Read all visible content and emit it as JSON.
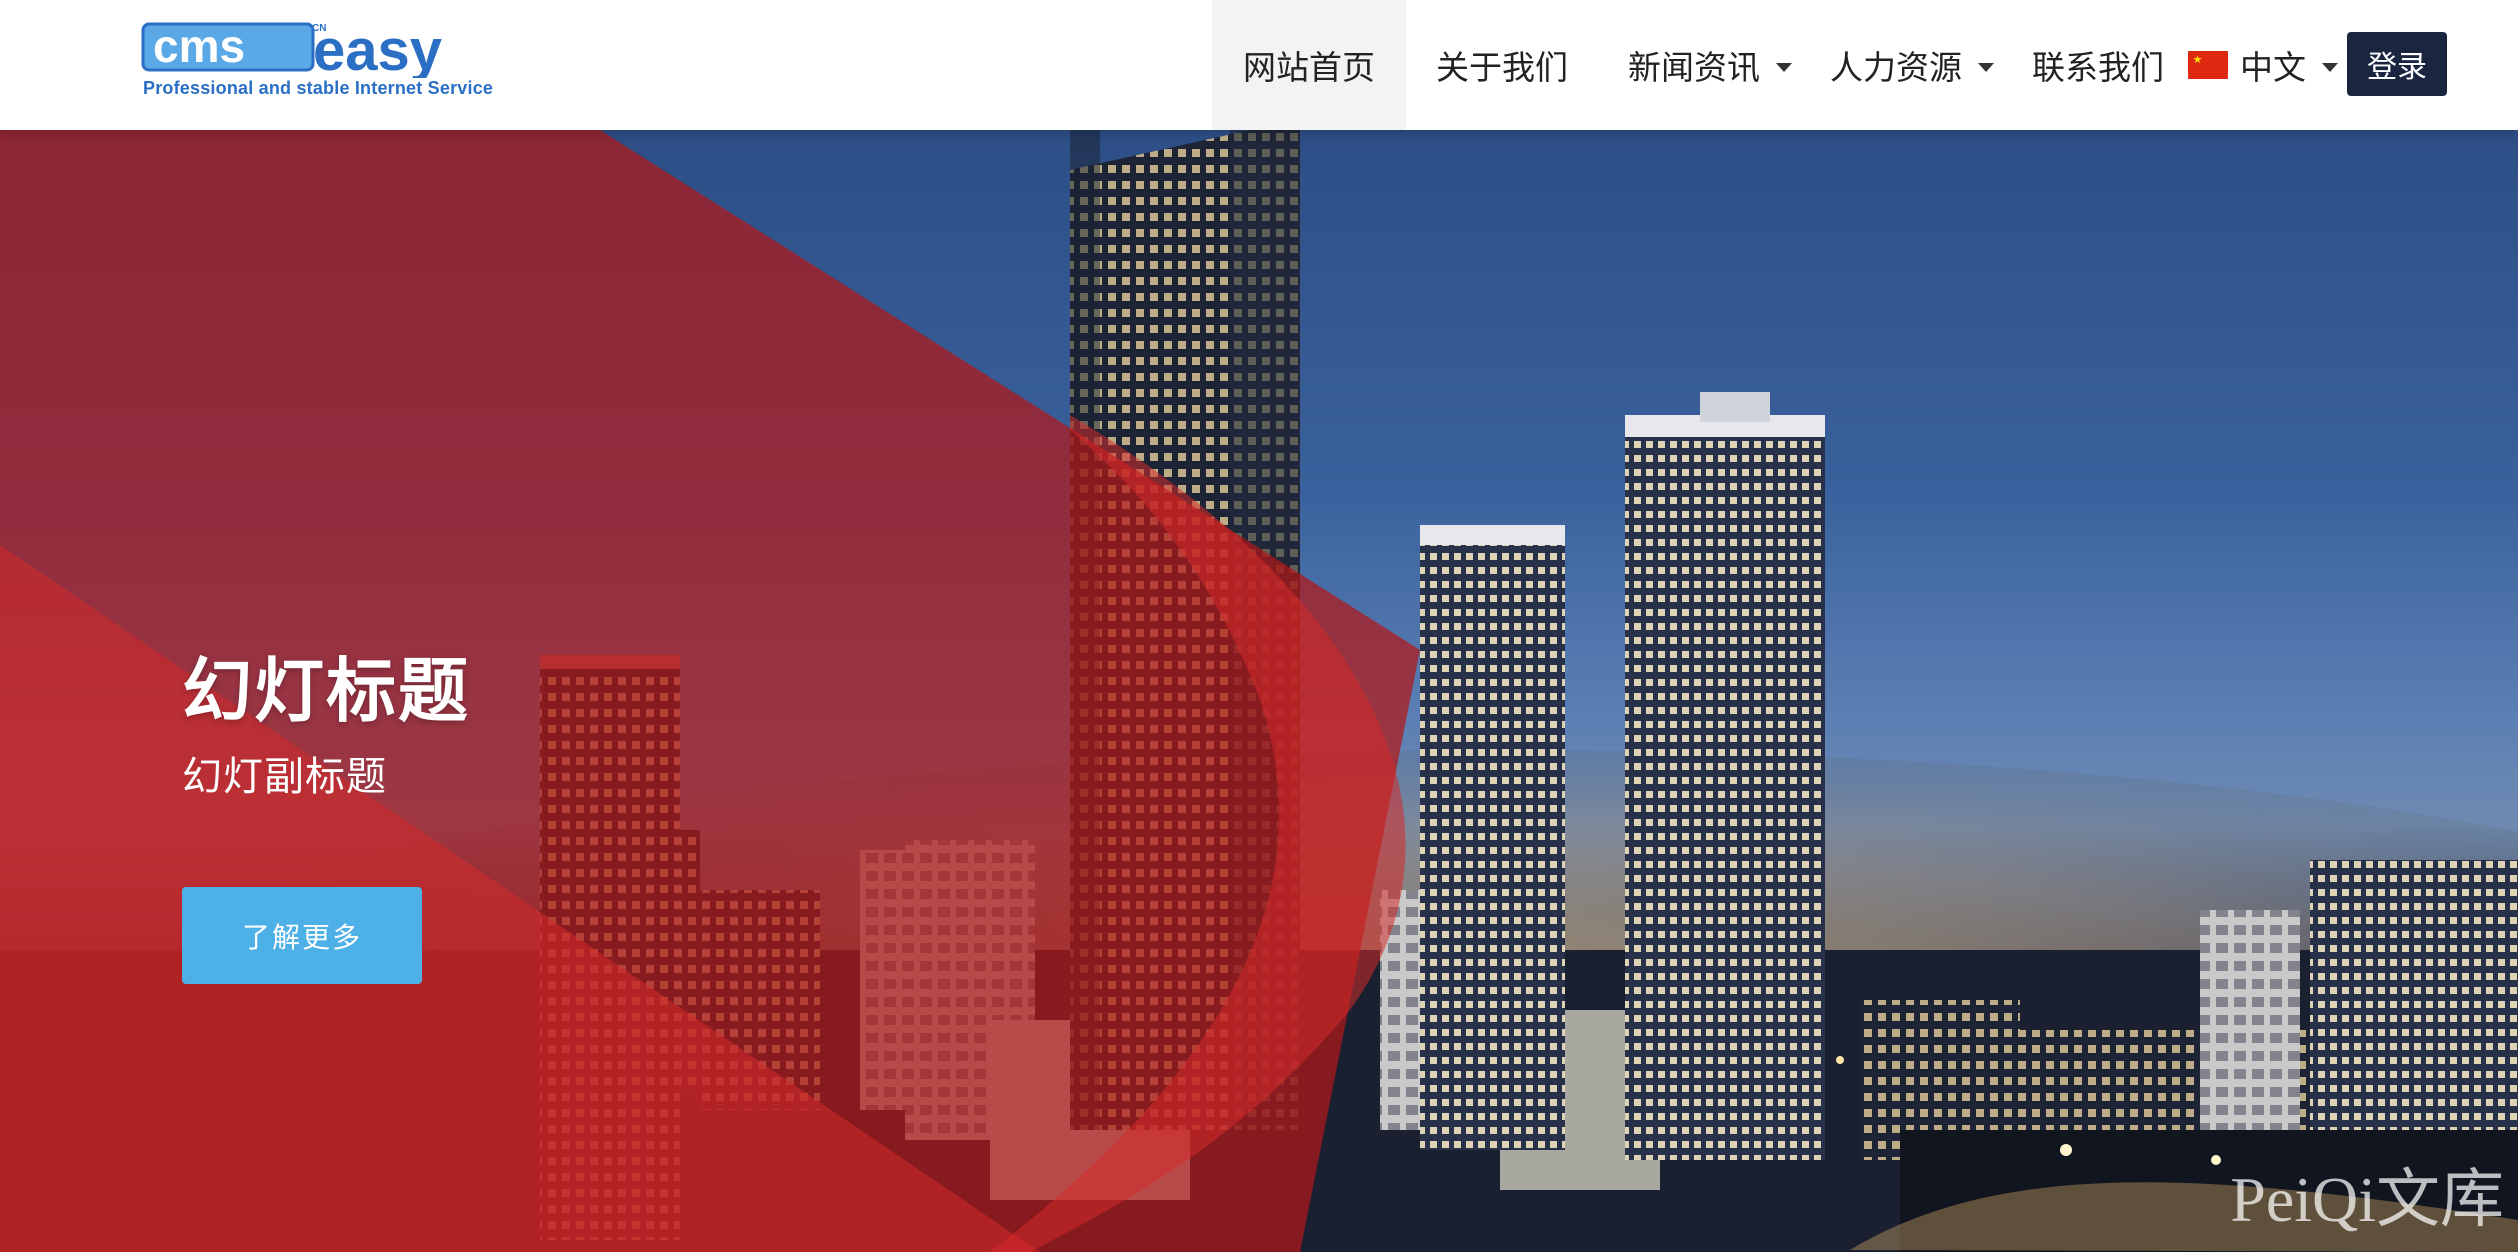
{
  "logo": {
    "brand_main": "cms",
    "brand_accent": "easy",
    "brand_badge": "CN",
    "tagline": "Professional and stable Internet Service"
  },
  "nav": {
    "items": [
      {
        "label": "网站首页",
        "active": true,
        "dropdown": false
      },
      {
        "label": "关于我们",
        "active": false,
        "dropdown": false
      },
      {
        "label": "新闻资讯",
        "active": false,
        "dropdown": true
      },
      {
        "label": "人力资源",
        "active": false,
        "dropdown": true
      },
      {
        "label": "联系我们",
        "active": false,
        "dropdown": false
      }
    ],
    "language": "中文",
    "login": "登录"
  },
  "hero": {
    "title": "幻灯标题",
    "subtitle": "幻灯副标题",
    "button": "了解更多",
    "watermark": "PeiQi文库"
  },
  "colors": {
    "brand_blue": "#2a6fc4",
    "login_bg": "#1a2540",
    "cta_bg": "#4db0e6",
    "overlay_red": "#d42a2a"
  },
  "icons": [
    "china-flag-icon",
    "chevron-down-icon"
  ]
}
